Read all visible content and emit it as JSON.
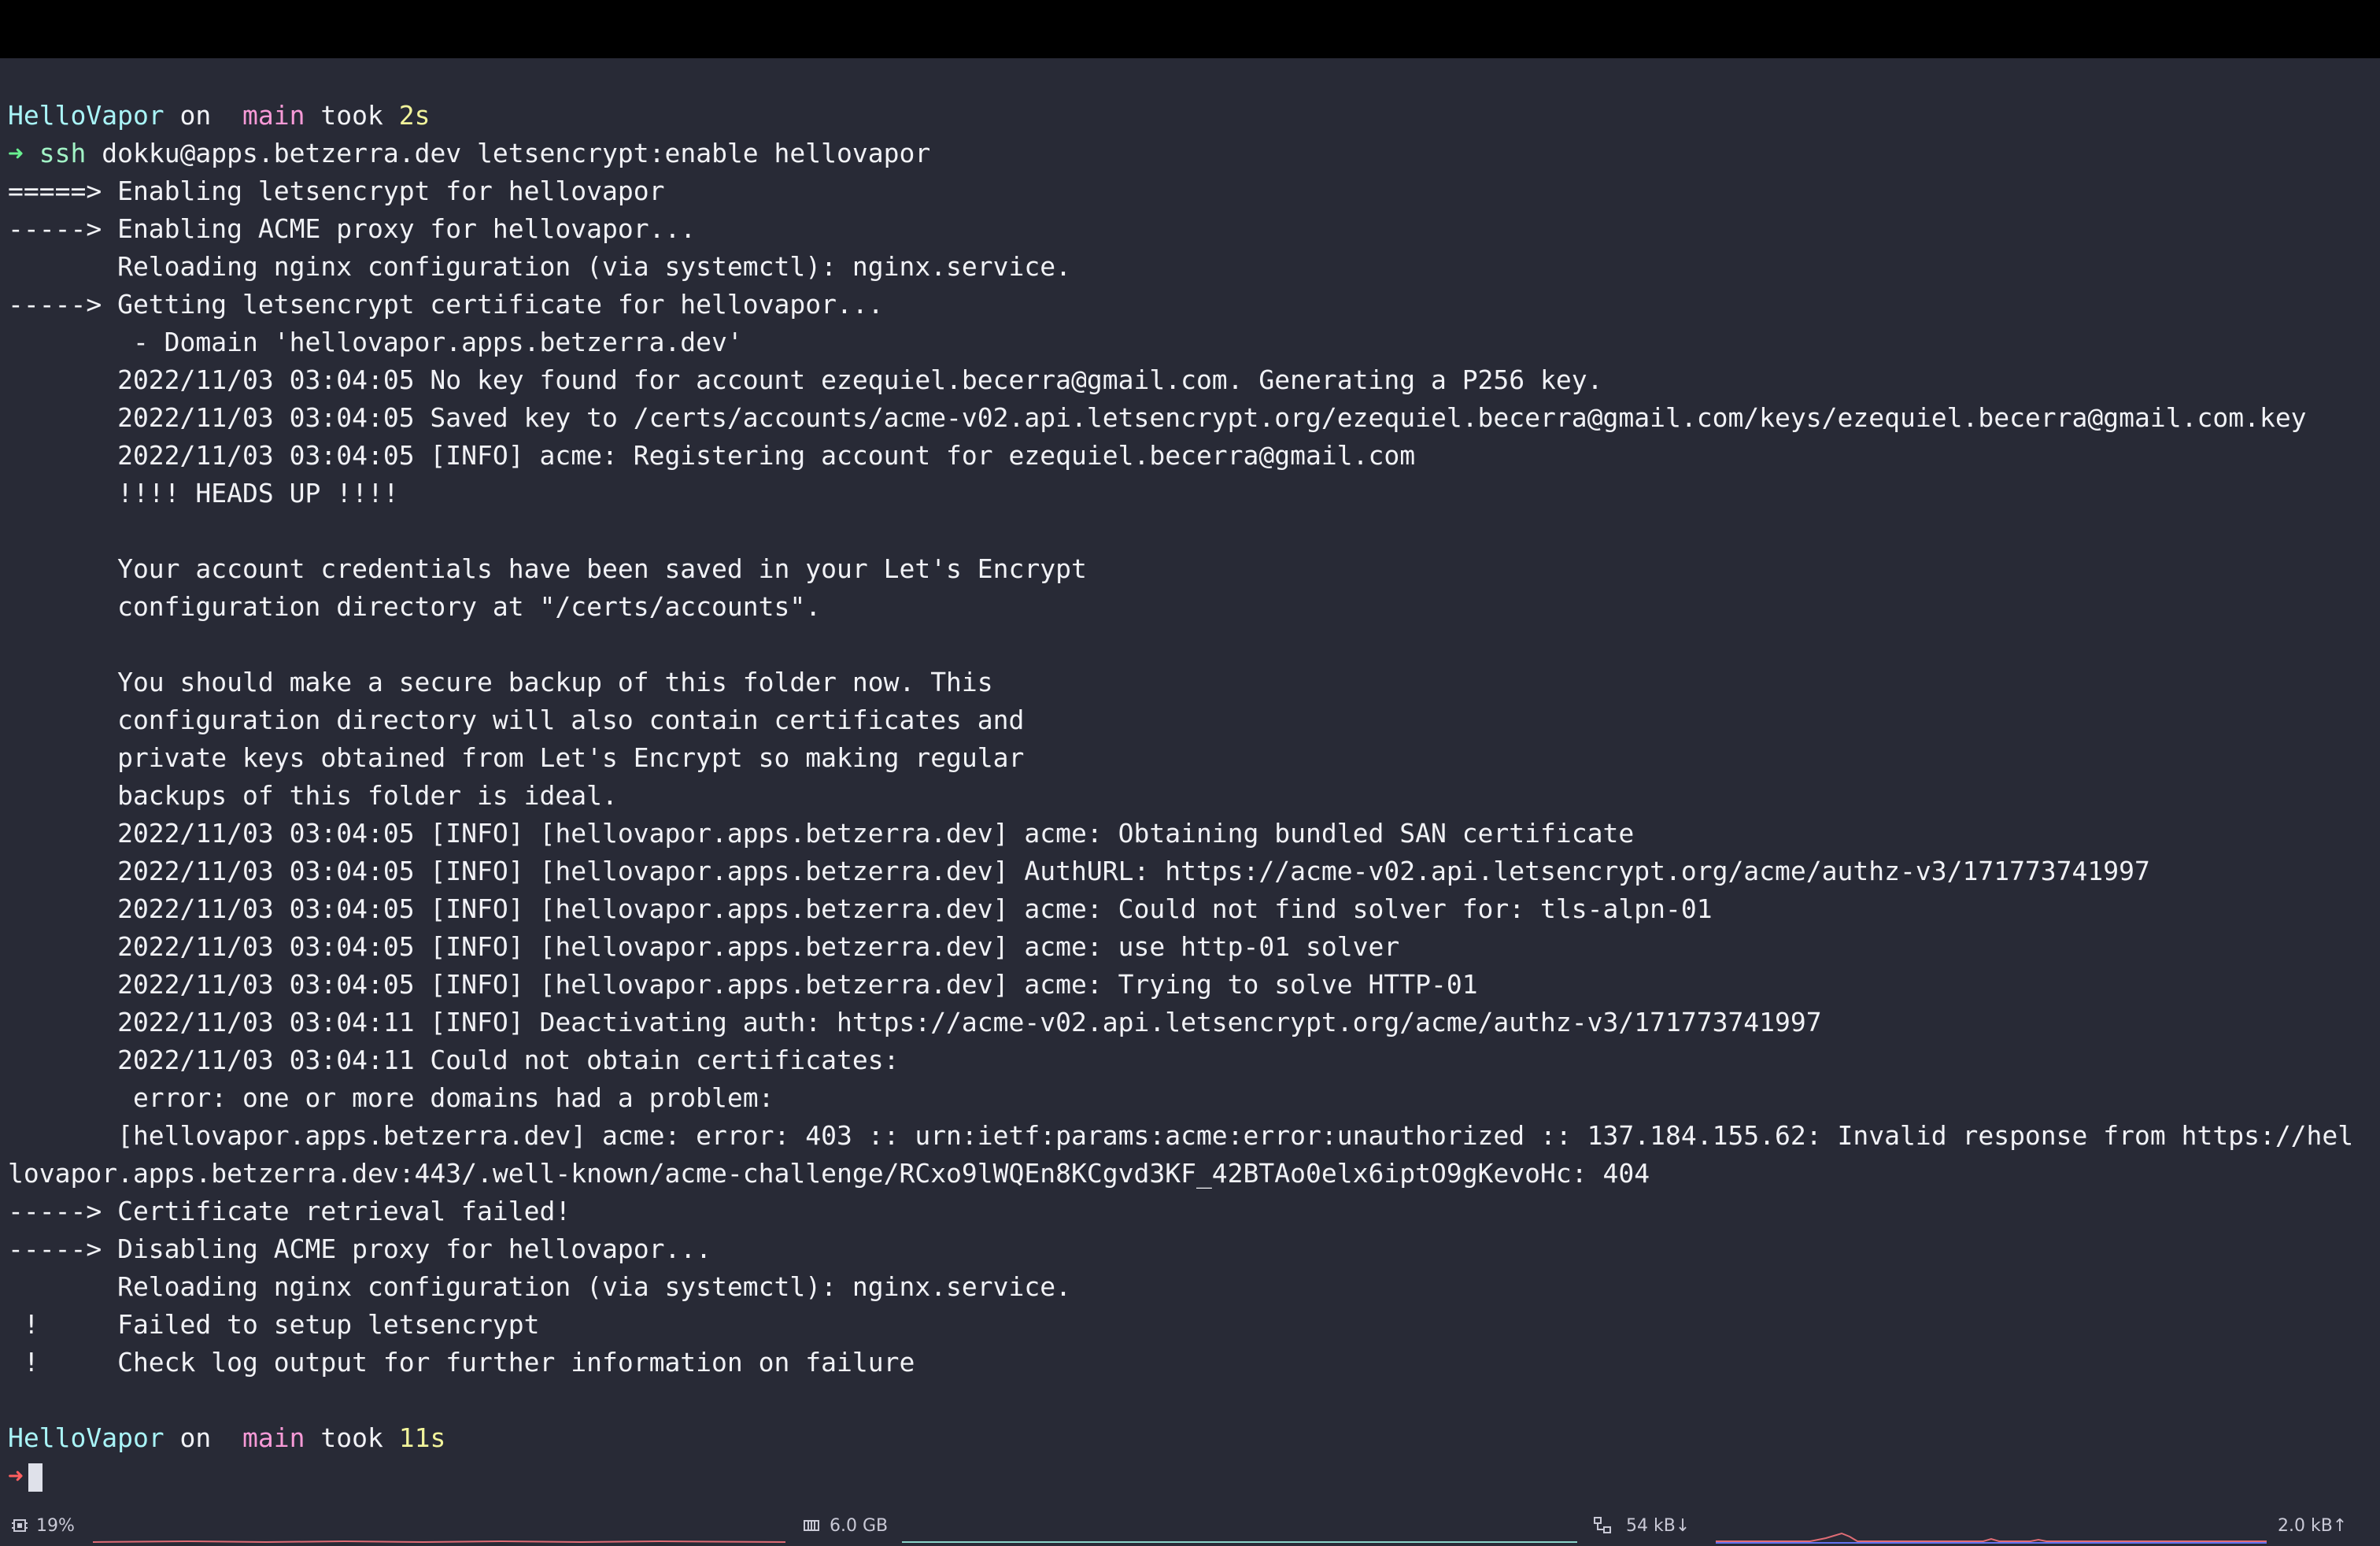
{
  "terminal": {
    "prompt1": {
      "dir": "HelloVapor",
      "on": " on ",
      "branch_icon": "",
      "branch": "main",
      "took": " took ",
      "time": "2s"
    },
    "command": {
      "arrow": "➜",
      "name": "ssh",
      "args": " dokku@apps.betzerra.dev letsencrypt:enable hellovapor"
    },
    "output": [
      "=====> Enabling letsencrypt for hellovapor",
      "-----> Enabling ACME proxy for hellovapor...",
      "       Reloading nginx configuration (via systemctl): nginx.service.",
      "-----> Getting letsencrypt certificate for hellovapor...",
      "        - Domain 'hellovapor.apps.betzerra.dev'",
      "       2022/11/03 03:04:05 No key found for account ezequiel.becerra@gmail.com. Generating a P256 key.",
      "       2022/11/03 03:04:05 Saved key to /certs/accounts/acme-v02.api.letsencrypt.org/ezequiel.becerra@gmail.com/keys/ezequiel.becerra@gmail.com.key",
      "       2022/11/03 03:04:05 [INFO] acme: Registering account for ezequiel.becerra@gmail.com",
      "       !!!! HEADS UP !!!!",
      "",
      "       Your account credentials have been saved in your Let's Encrypt",
      "       configuration directory at \"/certs/accounts\".",
      "",
      "       You should make a secure backup of this folder now. This",
      "       configuration directory will also contain certificates and",
      "       private keys obtained from Let's Encrypt so making regular",
      "       backups of this folder is ideal.",
      "       2022/11/03 03:04:05 [INFO] [hellovapor.apps.betzerra.dev] acme: Obtaining bundled SAN certificate",
      "       2022/11/03 03:04:05 [INFO] [hellovapor.apps.betzerra.dev] AuthURL: https://acme-v02.api.letsencrypt.org/acme/authz-v3/171773741997",
      "       2022/11/03 03:04:05 [INFO] [hellovapor.apps.betzerra.dev] acme: Could not find solver for: tls-alpn-01",
      "       2022/11/03 03:04:05 [INFO] [hellovapor.apps.betzerra.dev] acme: use http-01 solver",
      "       2022/11/03 03:04:05 [INFO] [hellovapor.apps.betzerra.dev] acme: Trying to solve HTTP-01",
      "       2022/11/03 03:04:11 [INFO] Deactivating auth: https://acme-v02.api.letsencrypt.org/acme/authz-v3/171773741997",
      "       2022/11/03 03:04:11 Could not obtain certificates:",
      "        error: one or more domains had a problem:",
      "       [hellovapor.apps.betzerra.dev] acme: error: 403 :: urn:ietf:params:acme:error:unauthorized :: 137.184.155.62: Invalid response from https://hel",
      "lovapor.apps.betzerra.dev:443/.well-known/acme-challenge/RCxo9lWQEn8KCgvd3KF_42BTAo0elx6iptO9gKevoHc: 404",
      "-----> Certificate retrieval failed!",
      "-----> Disabling ACME proxy for hellovapor...",
      "       Reloading nginx configuration (via systemctl): nginx.service.",
      " !     Failed to setup letsencrypt",
      " !     Check log output for further information on failure",
      ""
    ],
    "prompt2": {
      "dir": "HelloVapor",
      "on": " on ",
      "branch_icon": "",
      "branch": "main",
      "took": " took ",
      "time": "11s"
    },
    "input_prompt": {
      "arrow": "➜"
    }
  },
  "statusbar": {
    "cpu_icon": "cpu-icon",
    "cpu": "19%",
    "memory_icon": "memory-icon",
    "memory": "6.0 GB",
    "network_icon": "network-icon",
    "download": "54 kB↓",
    "upload": "2.0 kB↑"
  }
}
